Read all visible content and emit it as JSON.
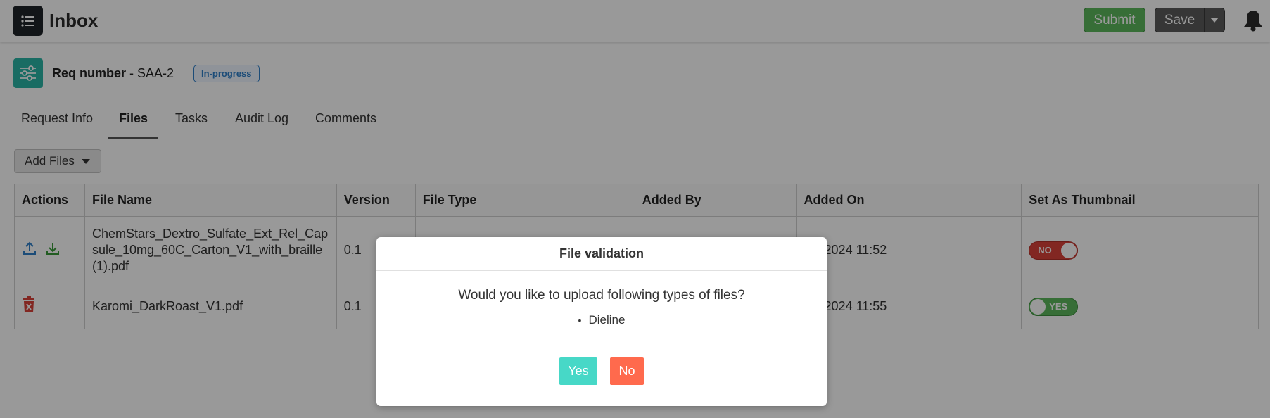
{
  "header": {
    "title": "Inbox",
    "submit_label": "Submit",
    "save_label": "Save"
  },
  "request": {
    "label_bold": "Req number",
    "label_sep": " - ",
    "number": "SAA-2",
    "status": "In-progress"
  },
  "tabs": [
    {
      "label": "Request Info",
      "active": false
    },
    {
      "label": "Files",
      "active": true
    },
    {
      "label": "Tasks",
      "active": false
    },
    {
      "label": "Audit Log",
      "active": false
    },
    {
      "label": "Comments",
      "active": false
    }
  ],
  "add_files_label": "Add Files",
  "table": {
    "columns": [
      "Actions",
      "File Name",
      "Version",
      "File Type",
      "Added By",
      "Added On",
      "Set As Thumbnail"
    ],
    "rows": [
      {
        "file_name": "ChemStars_Dextro_Sulfate_Ext_Rel_Capsule_10mg_60C_Carton_V1_with_braille (1).pdf",
        "version": "0.1",
        "added_on": "Jul-2024 11:52",
        "thumbnail": "NO",
        "actions": [
          "upload-icon",
          "download-icon"
        ]
      },
      {
        "file_name": "Karomi_DarkRoast_V1.pdf",
        "version": "0.1",
        "added_on": "Jul-2024 11:55",
        "thumbnail": "YES",
        "actions": [
          "delete-icon"
        ]
      }
    ]
  },
  "modal": {
    "title": "File validation",
    "question": "Would you like to upload following types of files?",
    "items": [
      "Dieline"
    ],
    "yes_label": "Yes",
    "no_label": "No"
  },
  "colors": {
    "accent_teal": "#2bb5a5",
    "submit_green": "#5cb85c",
    "status_blue": "#2f7fc9",
    "yes_button": "#47d8c7",
    "no_button": "#ff6a4d",
    "toggle_off": "#d9423a",
    "toggle_on": "#5cb85c"
  }
}
